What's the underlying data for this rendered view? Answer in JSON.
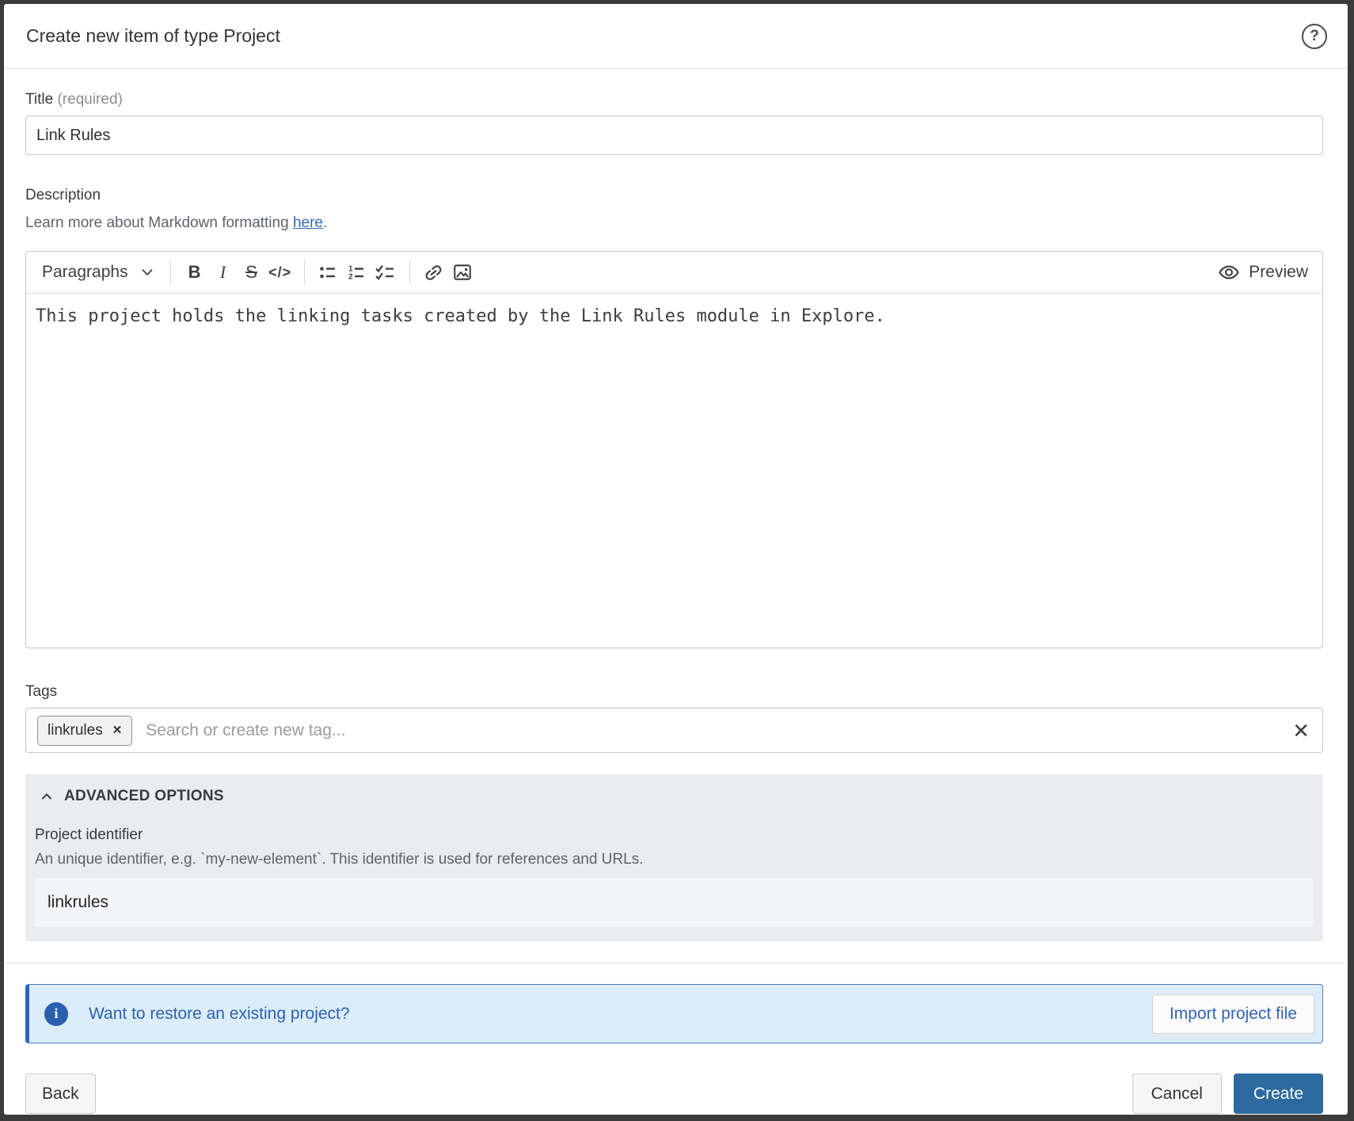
{
  "dialog": {
    "title": "Create new item of type Project"
  },
  "title_field": {
    "label": "Title",
    "required_hint": "(required)",
    "value": "Link Rules"
  },
  "description_field": {
    "label": "Description",
    "hint_prefix": "Learn more about Markdown formatting ",
    "hint_link": "here",
    "hint_suffix": ".",
    "value": "This project holds the linking tasks created by the Link Rules module in Explore."
  },
  "editor_toolbar": {
    "block_type_selected": "Paragraphs",
    "preview_label": "Preview"
  },
  "glyphs": {
    "bold": "B",
    "italic": "I",
    "strikethrough": "S",
    "code": "</>",
    "question": "?",
    "info": "i",
    "close": "✕"
  },
  "tags_field": {
    "label": "Tags",
    "tags": [
      {
        "label": "linkrules"
      }
    ],
    "placeholder": "Search or create new tag..."
  },
  "advanced_options": {
    "header": "ADVANCED OPTIONS",
    "identifier": {
      "label": "Project identifier",
      "description": "An unique identifier, e.g. `my-new-element`. This identifier is used for references and URLs.",
      "value": "linkrules"
    }
  },
  "restore_banner": {
    "message": "Want to restore an existing project?",
    "button_label": "Import project file"
  },
  "footer": {
    "back_label": "Back",
    "cancel_label": "Cancel",
    "create_label": "Create"
  },
  "colors": {
    "primary_button": "#2d6a9f",
    "banner_background": "#ddecf9",
    "banner_accent": "#2f66b4",
    "advanced_background": "#e9edf2",
    "link_blue": "#2a6bb8"
  }
}
